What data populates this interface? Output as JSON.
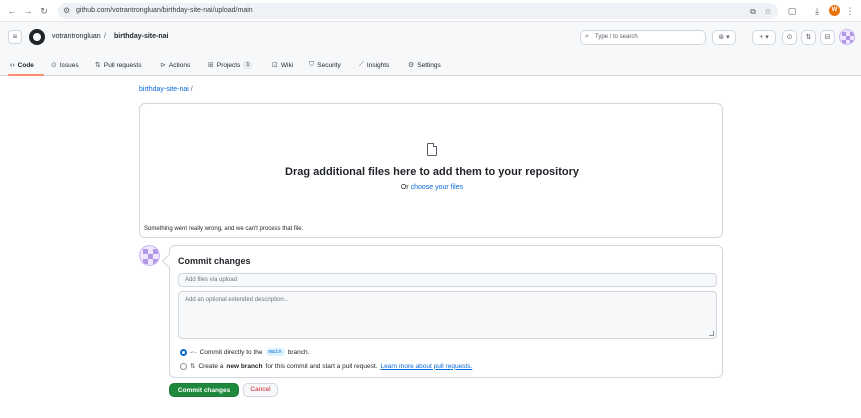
{
  "browser": {
    "url": "github.com/votrantrongluan/birthday-site-nai/upload/main",
    "icons": [
      "back-icon",
      "forward-icon",
      "reload-icon",
      "site-settings-icon",
      "install-icon",
      "bookmark-star-icon",
      "extensions-icon",
      "download-icon",
      "profile-icon",
      "menu-icon"
    ],
    "profile_initial": "W"
  },
  "header": {
    "owner": "votrantrongluan",
    "separator": "/",
    "repo": "birthday-site-nai",
    "search_placeholder": "Type / to search"
  },
  "tabs": [
    {
      "label": "Code",
      "icon": "code-icon"
    },
    {
      "label": "Issues",
      "icon": "issue-icon"
    },
    {
      "label": "Pull requests",
      "icon": "pull-request-icon"
    },
    {
      "label": "Actions",
      "icon": "play-icon"
    },
    {
      "label": "Projects",
      "icon": "table-icon",
      "count": "1"
    },
    {
      "label": "Wiki",
      "icon": "book-icon"
    },
    {
      "label": "Security",
      "icon": "shield-icon"
    },
    {
      "label": "Insights",
      "icon": "graph-icon"
    },
    {
      "label": "Settings",
      "icon": "gear-icon"
    }
  ],
  "breadcrumb": {
    "repo": "birthday-site-nai",
    "slash": "/"
  },
  "dropzone": {
    "title": "Drag additional files here to add them to your repository",
    "prefix": "Or ",
    "link": "choose your files",
    "error": "Something went really wrong, and we can't process that file."
  },
  "commit": {
    "title": "Commit changes",
    "summary_placeholder": "Add files via upload",
    "description_placeholder": "Add an optional extended description...",
    "option_direct_prefix": "Commit directly to the",
    "branch": "main",
    "option_direct_suffix": "branch.",
    "option_new_prefix": "Create a",
    "option_new_bold": "new branch",
    "option_new_mid": "for this commit and start a pull request.",
    "option_new_link": "Learn more about pull requests.",
    "submit_label": "Commit changes",
    "cancel_label": "Cancel"
  },
  "colors": {
    "accent_link": "#0969da",
    "primary_button": "#1f883d",
    "danger_text": "#cf222e",
    "tab_underline": "#fd8c73"
  }
}
